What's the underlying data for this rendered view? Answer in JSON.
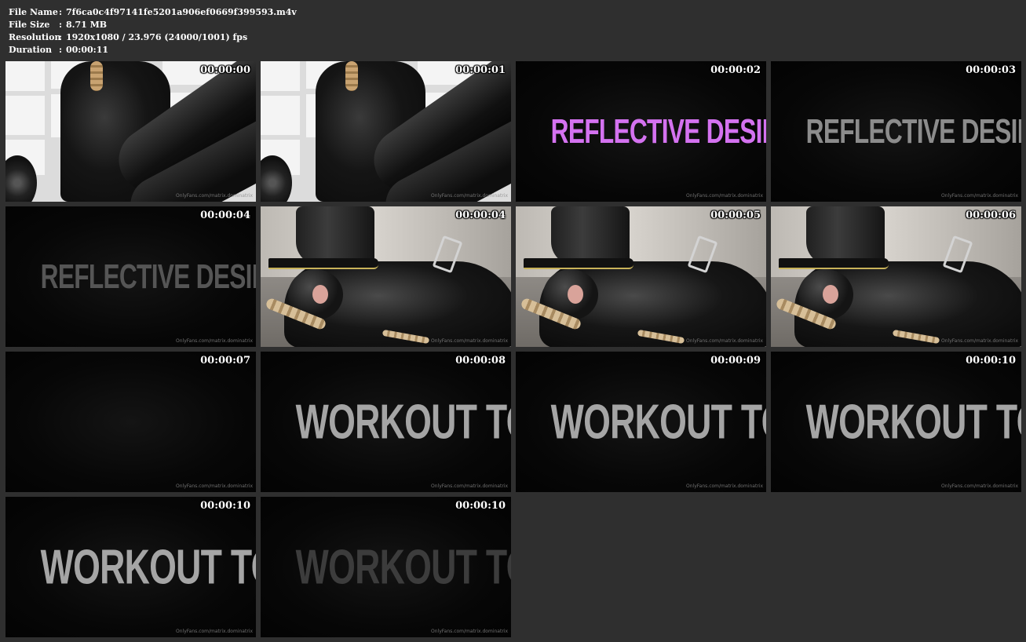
{
  "file_info": [
    {
      "key": "File Name",
      "sep": ":",
      "value": "7f6ca0c4f97141fe5201a906ef0669f399593.m4v"
    },
    {
      "key": "File Size",
      "sep": ":",
      "value": "8.71 MB"
    },
    {
      "key": "Resolution",
      "sep": ":",
      "value": "1920x1080 / 23.976 (24000/1001) fps"
    },
    {
      "key": "Duration",
      "sep": ":",
      "value": "00:00:11"
    }
  ],
  "watermark": "OnlyFans.com/matrix.dominatrix",
  "thumbnails": [
    {
      "time": "00:00:00",
      "scene": "window"
    },
    {
      "time": "00:00:01",
      "scene": "window"
    },
    {
      "time": "00:00:02",
      "scene": "title",
      "title": "REFLECTIVE DESIRE",
      "style": "pink"
    },
    {
      "time": "00:00:03",
      "scene": "title",
      "title": "REFLECTIVE DESIRE",
      "style": "gray"
    },
    {
      "time": "00:00:04",
      "scene": "title",
      "title": "REFLECTIVE DESIRE",
      "style": "dark"
    },
    {
      "time": "00:00:04",
      "scene": "boot"
    },
    {
      "time": "00:00:05",
      "scene": "boot"
    },
    {
      "time": "00:00:06",
      "scene": "boot"
    },
    {
      "time": "00:00:07",
      "scene": "title",
      "title": "",
      "style": "frag"
    },
    {
      "time": "00:00:08",
      "scene": "title",
      "title": "WORKOUT TOY",
      "style": "lite"
    },
    {
      "time": "00:00:09",
      "scene": "title",
      "title": "WORKOUT TOY",
      "style": "lite"
    },
    {
      "time": "00:00:10",
      "scene": "title",
      "title": "WORKOUT TOY",
      "style": "lite"
    },
    {
      "time": "00:00:10",
      "scene": "title",
      "title": "WORKOUT TOY",
      "style": "lite"
    },
    {
      "time": "00:00:10",
      "scene": "title",
      "title": "WORKOUT TOY",
      "style": "dim"
    }
  ],
  "colors": {
    "background": "#2f2f2f",
    "title_pink": "#d472f0",
    "title_gray": "#8c8c8c"
  }
}
